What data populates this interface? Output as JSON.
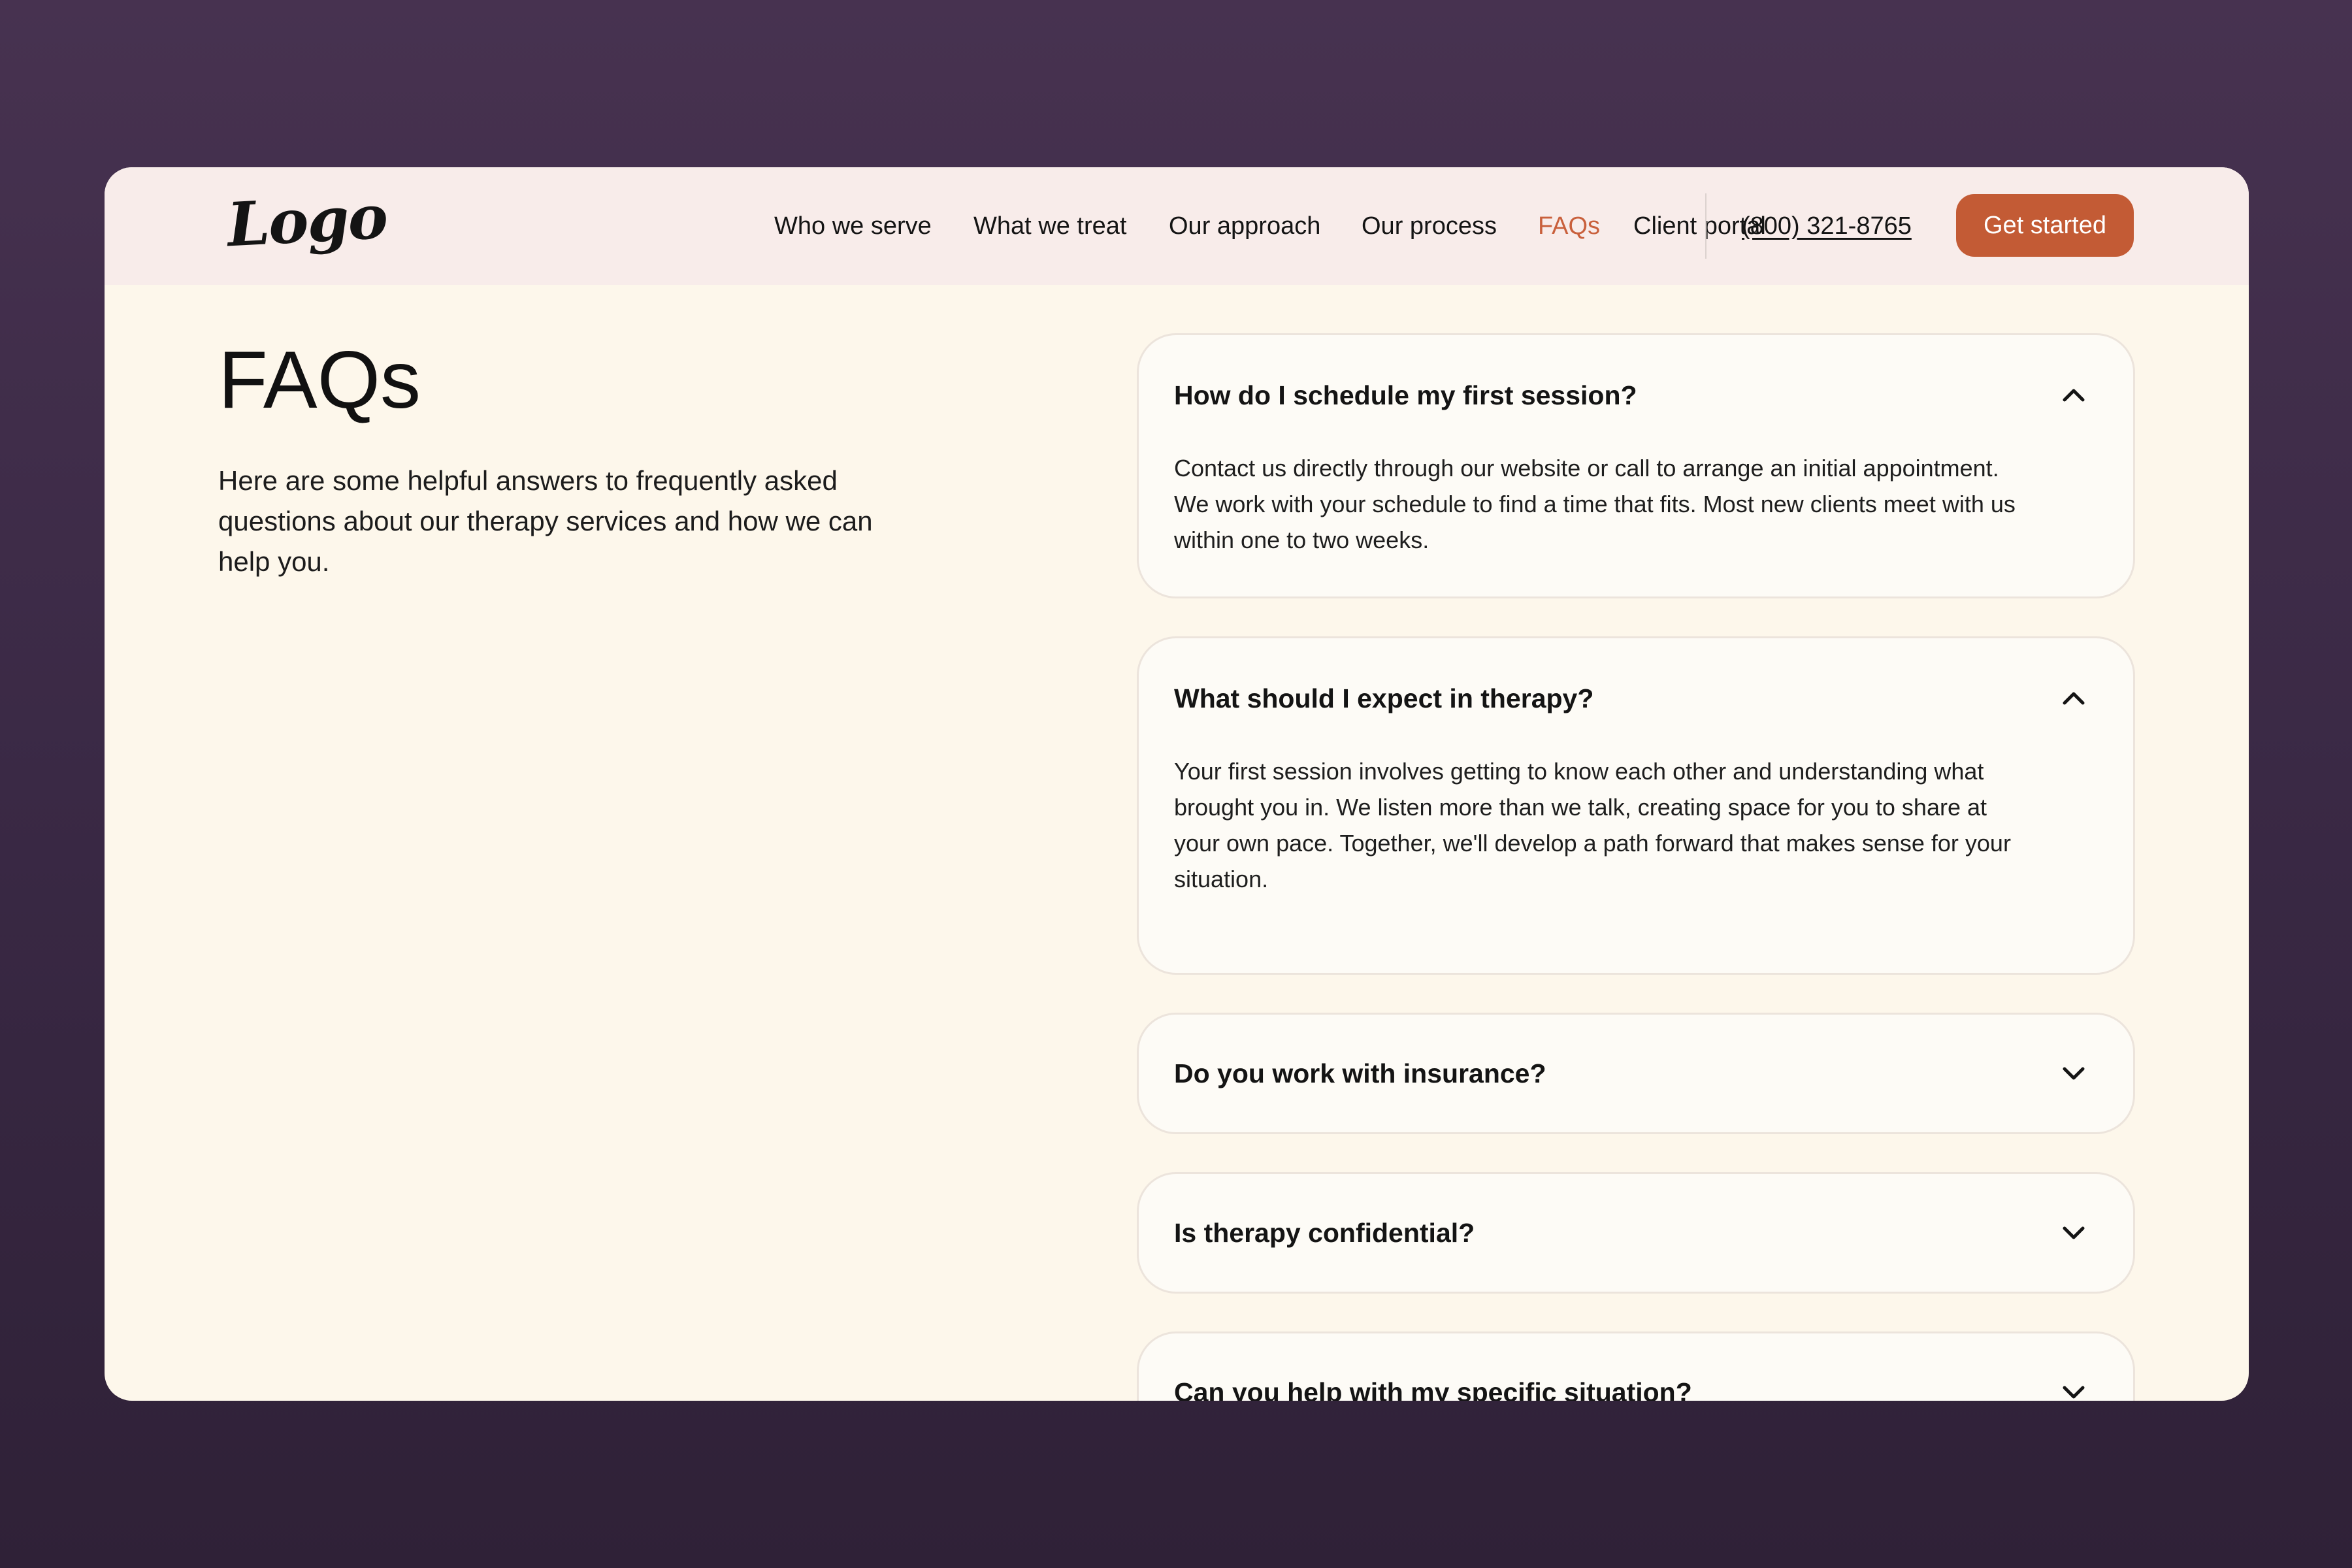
{
  "colors": {
    "backdrop": "#3a2945",
    "page_background": "#fdf7eb",
    "nav_background": "#f8ecea",
    "accent": "#c35b35",
    "active_link": "#c9603c",
    "card_border": "#ece4dc"
  },
  "header": {
    "logo_text": "Logo",
    "nav_items": [
      {
        "label": "Who we serve",
        "active": false
      },
      {
        "label": "What we treat",
        "active": false
      },
      {
        "label": "Our approach",
        "active": false
      },
      {
        "label": "Our process",
        "active": false
      },
      {
        "label": "FAQs",
        "active": true
      },
      {
        "label": "Client portal",
        "active": false
      }
    ],
    "phone": "(800) 321-8765",
    "cta_label": "Get started"
  },
  "intro": {
    "title": "FAQs",
    "description": "Here are some helpful answers to frequently asked questions about our therapy services and how we can help you."
  },
  "faqs": [
    {
      "question": "How do I schedule my first session?",
      "expanded": true,
      "icon": "chevron-up-icon",
      "answer": "Contact us directly through our website or call to arrange an initial appointment. We work with your schedule to find a time that fits. Most new clients meet with us within one to two weeks."
    },
    {
      "question": "What should I expect in therapy?",
      "expanded": true,
      "icon": "chevron-up-icon",
      "answer": "Your first session involves getting to know each other and understanding what brought you in. We listen more than we talk, creating space for you to share at your own pace. Together, we'll develop a path forward that makes sense for your situation."
    },
    {
      "question": "Do you work with insurance?",
      "expanded": false,
      "icon": "chevron-down-icon"
    },
    {
      "question": "Is therapy confidential?",
      "expanded": false,
      "icon": "chevron-down-icon"
    },
    {
      "question": "Can you help with my specific situation?",
      "expanded": false,
      "icon": "chevron-down-icon"
    }
  ]
}
